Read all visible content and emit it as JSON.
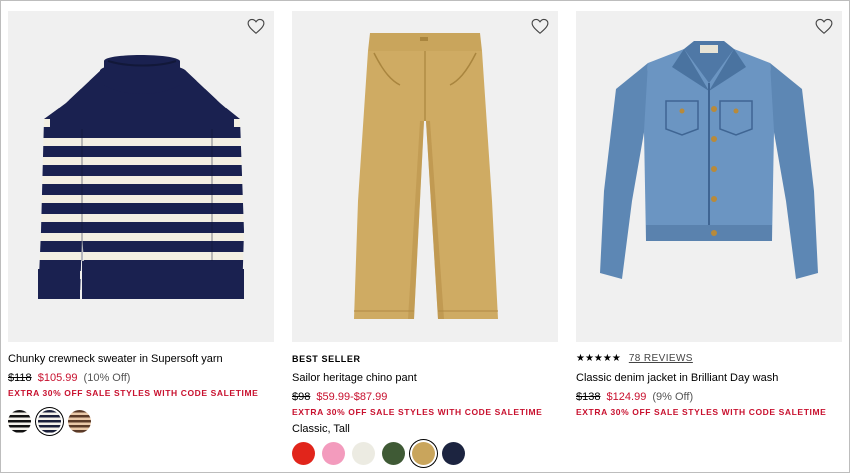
{
  "products": [
    {
      "name": "Chunky crewneck sweater in Supersoft yarn",
      "orig_price": "$118",
      "sale_price": "$105.99",
      "discount": "(10% Off)",
      "promo": "EXTRA 30% OFF SALE STYLES WITH CODE SALETIME",
      "swatches": [
        {
          "name": "black-ivory-stripe",
          "style": "stripe-a"
        },
        {
          "name": "navy-ivory-stripe",
          "style": "stripe-b",
          "selected": true
        },
        {
          "name": "brown-tan-stripe",
          "style": "stripe-c"
        }
      ]
    },
    {
      "badge": "BEST SELLER",
      "name": "Sailor heritage chino pant",
      "orig_price": "$98",
      "sale_price": "$59.99-$87.99",
      "promo": "EXTRA 30% OFF SALE STYLES WITH CODE SALETIME",
      "fits": "Classic, Tall",
      "swatches": [
        {
          "name": "red",
          "color": "#e1251b"
        },
        {
          "name": "pink",
          "color": "#f39bbd"
        },
        {
          "name": "ivory",
          "color": "#ecebe2"
        },
        {
          "name": "green",
          "color": "#3f5a35"
        },
        {
          "name": "khaki",
          "color": "#c9a55c",
          "selected": true
        },
        {
          "name": "navy",
          "color": "#1c2440"
        }
      ]
    },
    {
      "rating": 4.5,
      "stars": "★★★★★",
      "reviews": "78 REVIEWS",
      "name": "Classic denim jacket in Brilliant Day wash",
      "orig_price": "$138",
      "sale_price": "$124.99",
      "discount": "(9% Off)",
      "promo": "EXTRA 30% OFF SALE STYLES WITH CODE SALETIME"
    }
  ],
  "colors": {
    "sale_red": "#c8102e",
    "image_bg": "#f0f0f0"
  }
}
